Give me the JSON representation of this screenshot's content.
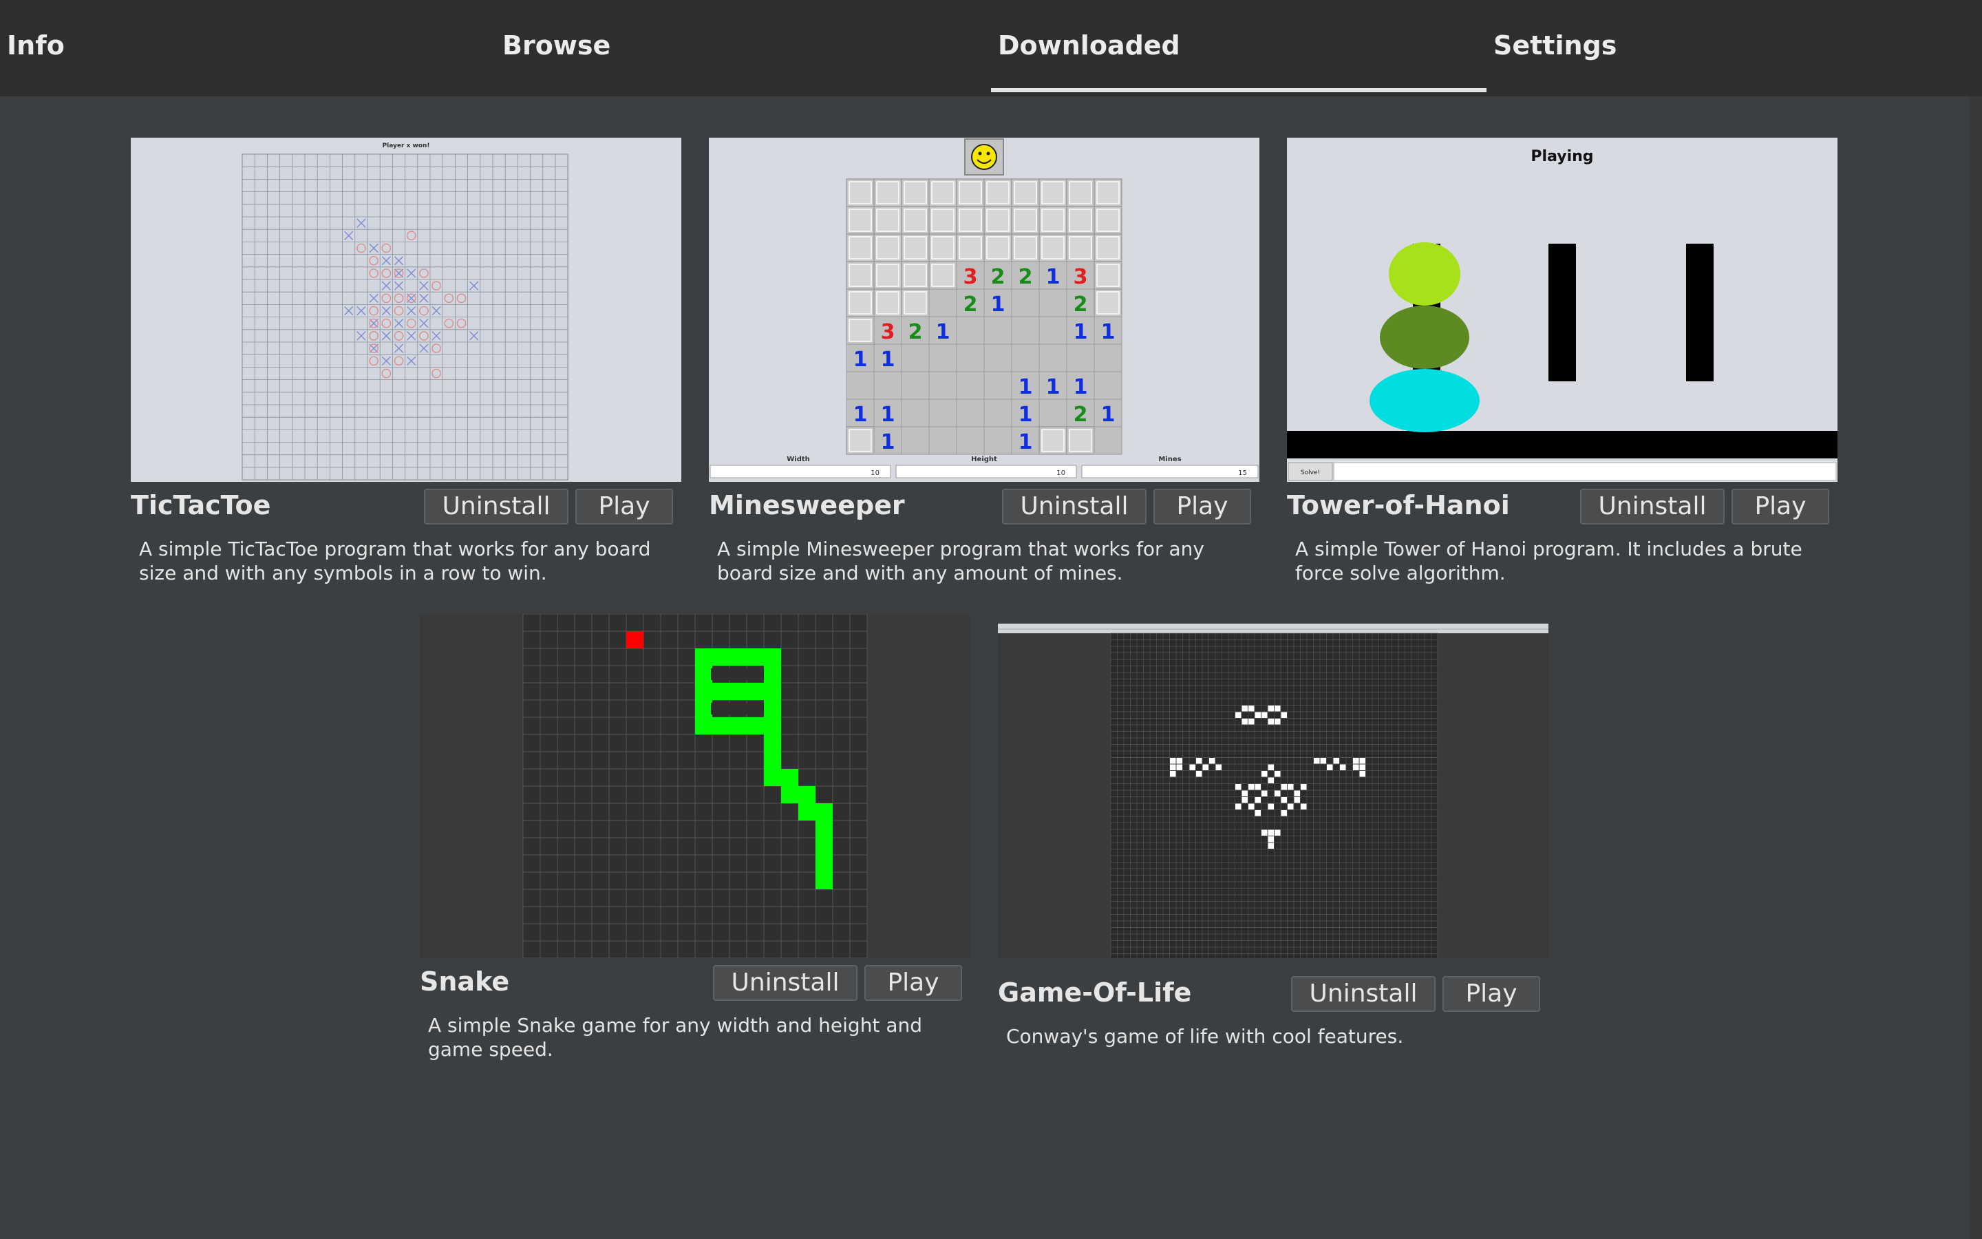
{
  "tabs": [
    {
      "label": "Info"
    },
    {
      "label": "Browse"
    },
    {
      "label": "Downloaded",
      "selected": true
    },
    {
      "label": "Settings"
    }
  ],
  "games": [
    {
      "title": "TicTacToe",
      "uninstall_label": "Uninstall",
      "play_label": "Play",
      "description": "A simple TicTacToe program that works for any board size and with any symbols in a row to win.",
      "thumb_status": "Player x won!"
    },
    {
      "title": "Minesweeper",
      "uninstall_label": "Uninstall",
      "play_label": "Play",
      "description": "A simple Minesweeper program that works for any board size and with any amount of mines.",
      "thumb_fields": [
        {
          "label": "Width",
          "value": "10"
        },
        {
          "label": "Height",
          "value": "10"
        },
        {
          "label": "Mines",
          "value": "15"
        }
      ]
    },
    {
      "title": "Tower-of-Hanoi",
      "uninstall_label": "Uninstall",
      "play_label": "Play",
      "description": "A simple Tower of Hanoi program. It includes a brute force solve algorithm.",
      "thumb_status": "Playing",
      "thumb_button": "Solve!",
      "disk_colors": [
        "#a8e01a",
        "#5d8a22",
        "#00dde0"
      ]
    },
    {
      "title": "Snake",
      "uninstall_label": "Uninstall",
      "play_label": "Play",
      "description": "A simple Snake game for any width and height and game speed.",
      "snake_color": "#00ff00",
      "food_color": "#ff0000"
    },
    {
      "title": "Game-Of-Life",
      "uninstall_label": "Uninstall",
      "play_label": "Play",
      "description": "Conway's game of life with cool features."
    }
  ]
}
